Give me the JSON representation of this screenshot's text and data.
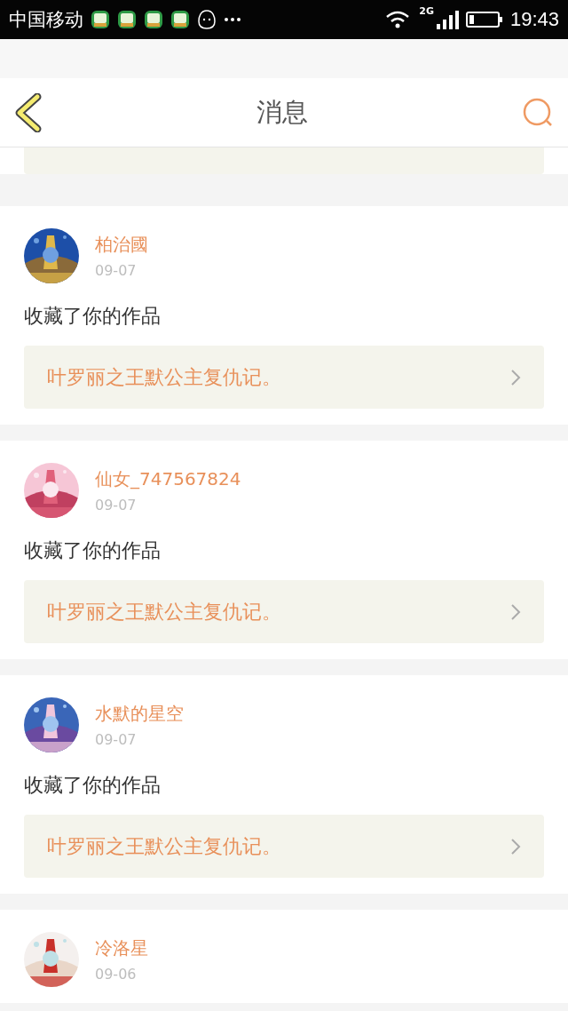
{
  "status_bar": {
    "carrier": "中国移动",
    "network": "2G",
    "time": "19:43"
  },
  "header": {
    "title": "消息"
  },
  "messages": [
    {
      "name": "柏治國",
      "date": "09-07",
      "action": "收藏了你的作品",
      "work": "叶罗丽之王默公主复仇记。"
    },
    {
      "name": "仙女_747567824",
      "date": "09-07",
      "action": "收藏了你的作品",
      "work": "叶罗丽之王默公主复仇记。"
    },
    {
      "name": "水默的星空",
      "date": "09-07",
      "action": "收藏了你的作品",
      "work": "叶罗丽之王默公主复仇记。"
    },
    {
      "name": "冷洛星",
      "date": "09-06"
    }
  ]
}
